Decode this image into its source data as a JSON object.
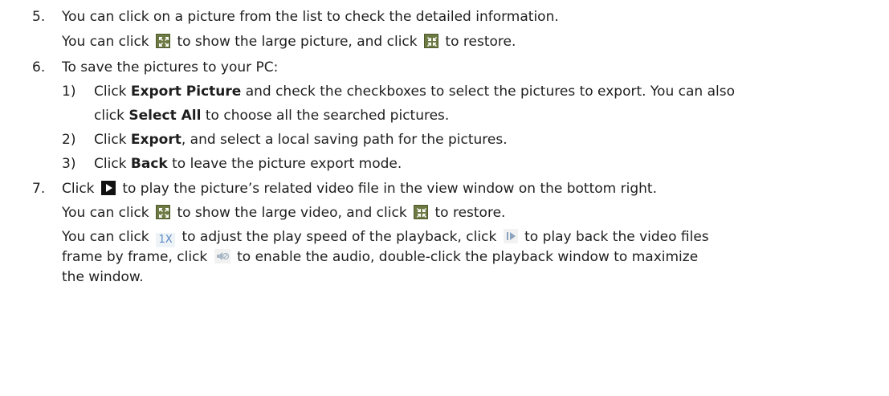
{
  "step5": {
    "num": "5.",
    "line1": "You can click on a picture from the list to check the detailed information.",
    "line2_a": "You can click",
    "line2_b": "to show the large picture, and click",
    "line2_c": "to restore."
  },
  "step6": {
    "num": "6.",
    "line1": "To save the pictures to your PC:",
    "sub1": {
      "num": "1)",
      "a": "Click ",
      "b": "Export Picture",
      "c": " and check the checkboxes to select the pictures to export. You can also",
      "d": "click ",
      "e": "Select All",
      "f": " to choose all the searched pictures."
    },
    "sub2": {
      "num": "2)",
      "a": "Click ",
      "b": "Export",
      "c": ", and select a local saving path for the pictures."
    },
    "sub3": {
      "num": "3)",
      "a": "Click ",
      "b": "Back",
      "c": " to leave the picture export mode."
    }
  },
  "step7": {
    "num": "7.",
    "line1_a": "Click",
    "line1_b": "to play the picture’s related video file in the view window on the bottom right.",
    "line2_a": "You can click",
    "line2_b": "to show the large video, and click",
    "line2_c": "to restore.",
    "line3_a": "You can click",
    "speed_label": "1X",
    "line3_b": "to adjust the play speed of the playback, click",
    "line3_c": "to play back the video files",
    "line4_a": "frame by frame, click",
    "line4_b": "to enable the audio, double-click the playback window to maximize",
    "line5": "the window."
  },
  "icons": {
    "maximize": "maximize-icon",
    "restore": "restore-icon",
    "play": "play-icon",
    "speed": "speed-icon",
    "frame": "frame-by-frame-icon",
    "audio": "audio-icon"
  }
}
